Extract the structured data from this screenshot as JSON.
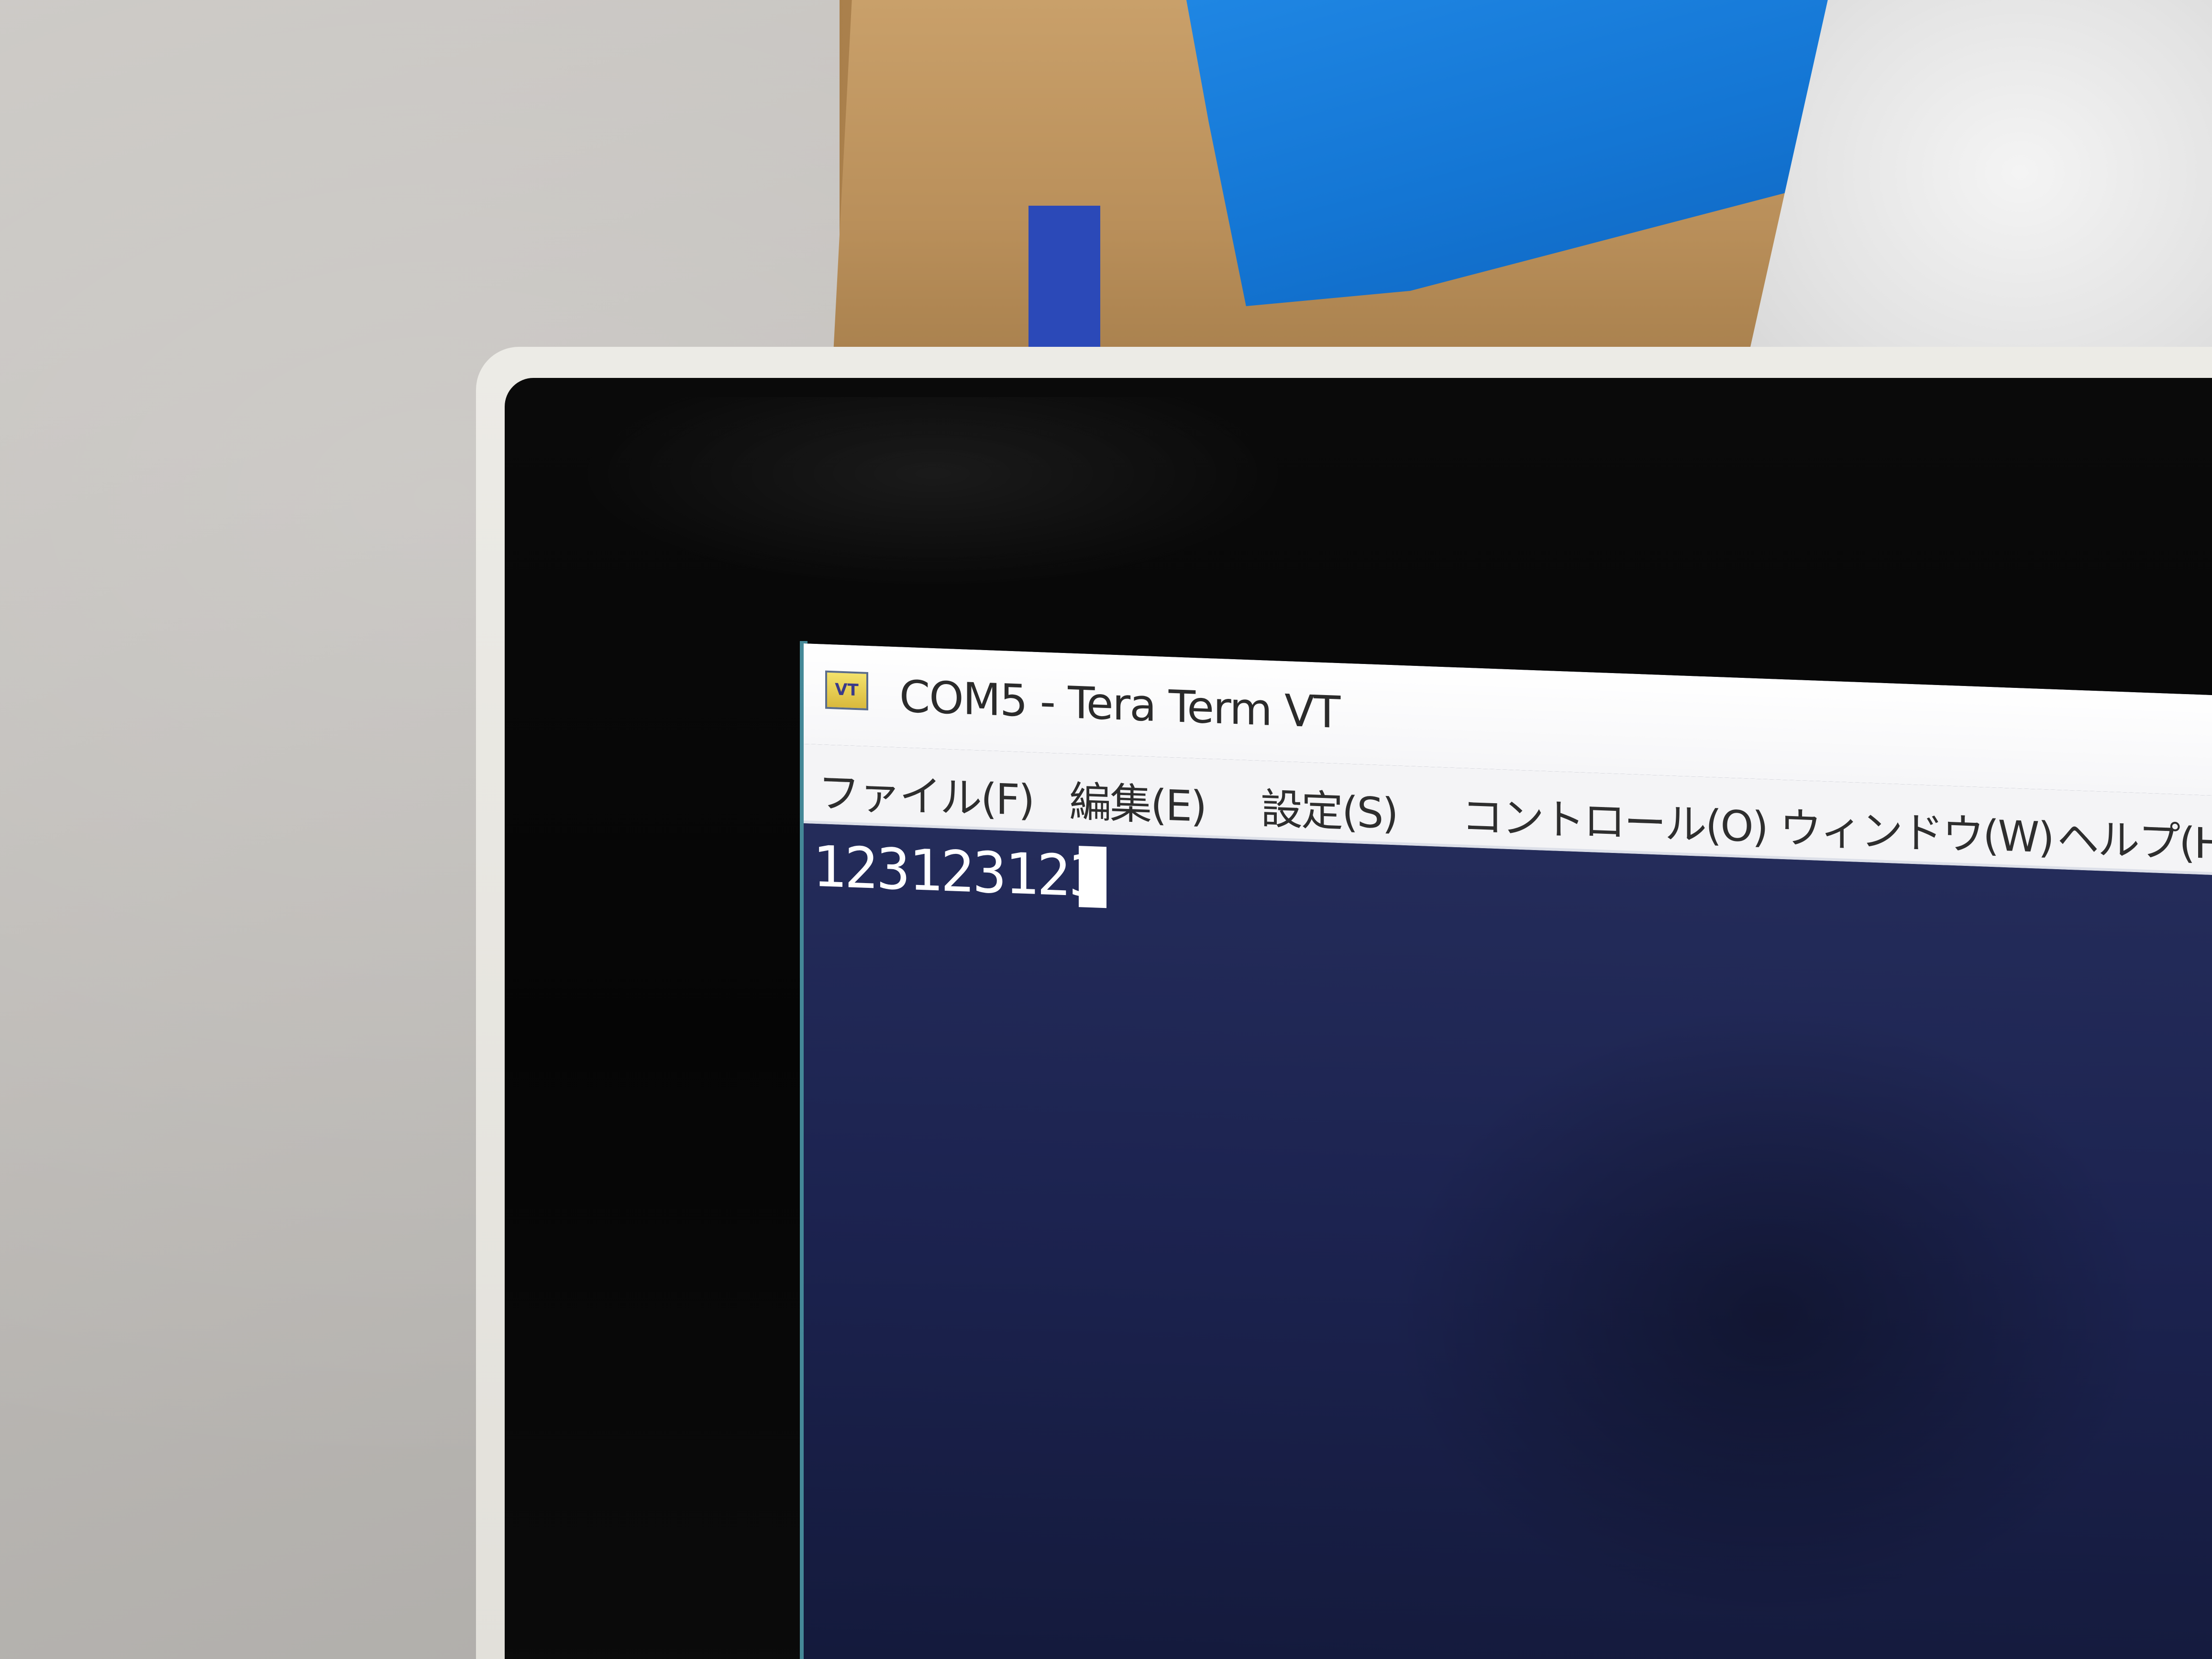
{
  "window": {
    "icon_text": "VT",
    "title": "COM5 - Tera Term VT"
  },
  "menu": {
    "items": [
      {
        "label": "ファイル(F)"
      },
      {
        "label": "編集(E)"
      },
      {
        "label": "設定(S)"
      },
      {
        "label": "コントロール(O)"
      },
      {
        "label": "ウィンドウ(W)"
      },
      {
        "label": "ヘルプ(H)"
      }
    ]
  },
  "terminal": {
    "lines": [
      "123123123"
    ]
  },
  "colors": {
    "terminal_bg": "#1c2350",
    "terminal_text": "#ffffff",
    "titlebar_bg": "#ffffff",
    "menubar_bg": "#f4f4f6"
  }
}
